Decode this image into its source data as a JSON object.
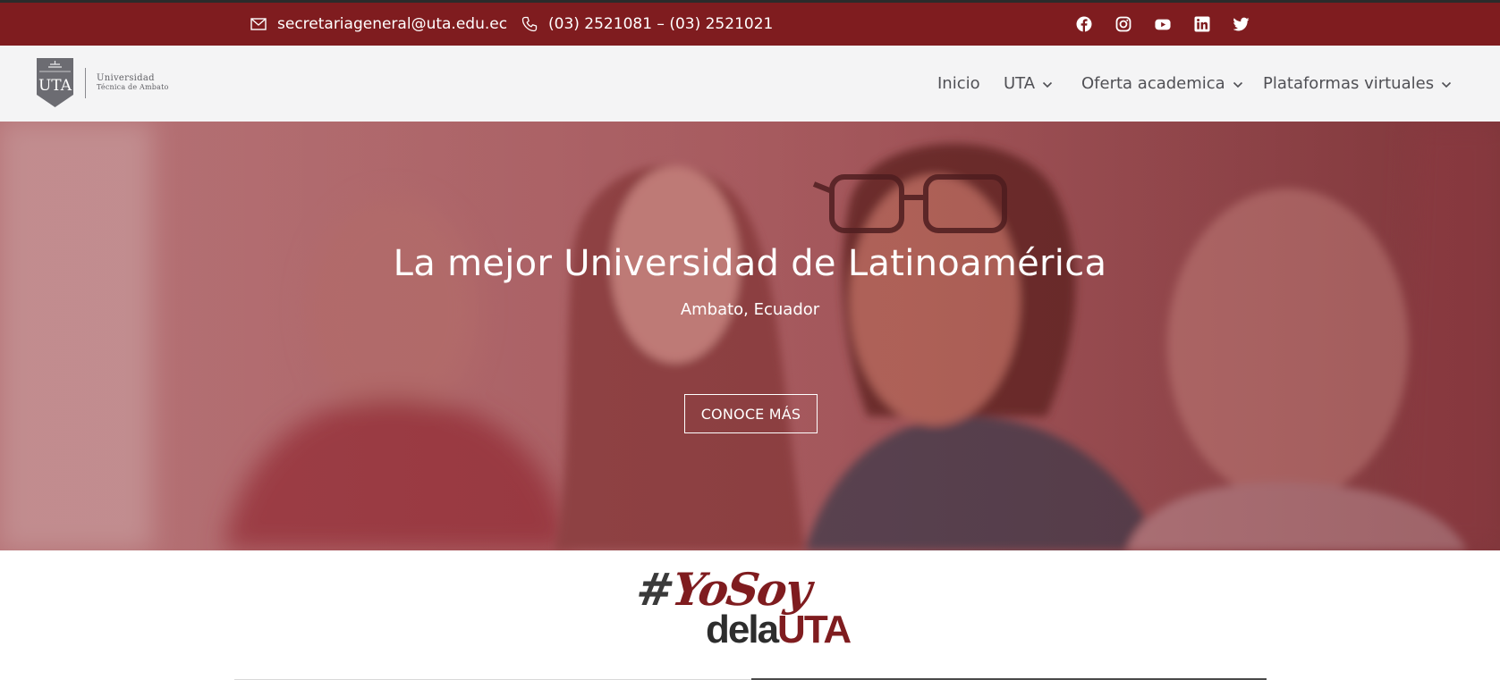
{
  "topbar": {
    "email": "secretariageneral@uta.edu.ec",
    "phone": "(03) 2521081 – (03) 2521021",
    "social": [
      "facebook-icon",
      "instagram-icon",
      "youtube-icon",
      "linkedin-icon",
      "twitter-icon"
    ]
  },
  "logo": {
    "mark": "UTA",
    "line1": "Universidad",
    "line2": "Técnica de Ambato"
  },
  "nav": {
    "items": [
      {
        "label": "Inicio",
        "dropdown": false
      },
      {
        "label": "UTA",
        "dropdown": true
      },
      {
        "label": "Oferta academica",
        "dropdown": true
      },
      {
        "label": "Plataformas virtuales",
        "dropdown": true
      }
    ]
  },
  "hero": {
    "title": "La mejor Universidad de Latinoamérica",
    "subtitle": "Ambato, Ecuador",
    "button": "CONOCE MÁS"
  },
  "campaign": {
    "hash": "#",
    "yosoy": "YoSoy",
    "dela": "dela",
    "uta": "UTA"
  },
  "colors": {
    "brand": "#7f1c1f",
    "nav_bg": "#f4f4f5",
    "nav_text": "#505055"
  }
}
